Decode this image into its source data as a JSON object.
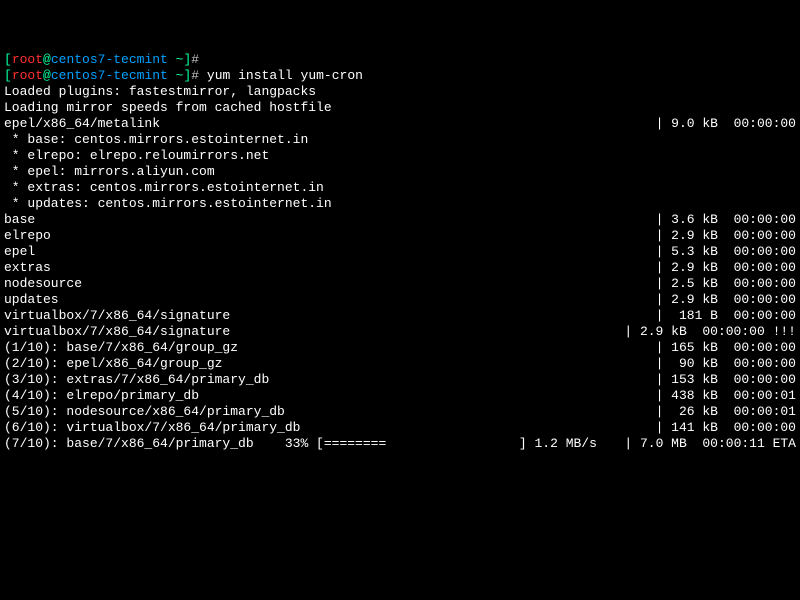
{
  "prompt": {
    "user": "root",
    "host": "centos7-tecmint",
    "cwd": "~",
    "symbol": "#"
  },
  "command": " yum install yum-cron",
  "plugins_line": "Loaded plugins: fastestmirror, langpacks",
  "loading_line": "Loading mirror speeds from cached hostfile",
  "metalink": {
    "left": "epel/x86_64/metalink",
    "right": "| 9.0 kB  00:00:00"
  },
  "mirrors": [
    " * base: centos.mirrors.estointernet.in",
    " * elrepo: elrepo.reloumirrors.net",
    " * epel: mirrors.aliyun.com",
    " * extras: centos.mirrors.estointernet.in",
    " * updates: centos.mirrors.estointernet.in"
  ],
  "repos": [
    {
      "left": "base",
      "right": "| 3.6 kB  00:00:00"
    },
    {
      "left": "elrepo",
      "right": "| 2.9 kB  00:00:00"
    },
    {
      "left": "epel",
      "right": "| 5.3 kB  00:00:00"
    },
    {
      "left": "extras",
      "right": "| 2.9 kB  00:00:00"
    },
    {
      "left": "nodesource",
      "right": "| 2.5 kB  00:00:00"
    },
    {
      "left": "updates",
      "right": "| 2.9 kB  00:00:00"
    },
    {
      "left": "virtualbox/7/x86_64/signature",
      "right": "|  181 B  00:00:00"
    },
    {
      "left": "virtualbox/7/x86_64/signature",
      "right": "| 2.9 kB  00:00:00",
      "suffix": " !!!"
    }
  ],
  "downloads": [
    {
      "left": "(1/10): base/7/x86_64/group_gz",
      "right": "| 165 kB  00:00:00"
    },
    {
      "left": "(2/10): epel/x86_64/group_gz",
      "right": "|  90 kB  00:00:00"
    },
    {
      "left": "(3/10): extras/7/x86_64/primary_db",
      "right": "| 153 kB  00:00:00"
    },
    {
      "left": "(4/10): elrepo/primary_db",
      "right": "| 438 kB  00:00:01"
    },
    {
      "left": "(5/10): nodesource/x86_64/primary_db",
      "right": "|  26 kB  00:00:01"
    },
    {
      "left": "(6/10): virtualbox/7/x86_64/primary_db",
      "right": "| 141 kB  00:00:00"
    }
  ],
  "progress": {
    "left": "(7/10): base/7/x86_64/primary_db    33% [========                 ] 1.2 MB/s",
    "right": "| 7.0 MB  00:00:11 ETA"
  }
}
